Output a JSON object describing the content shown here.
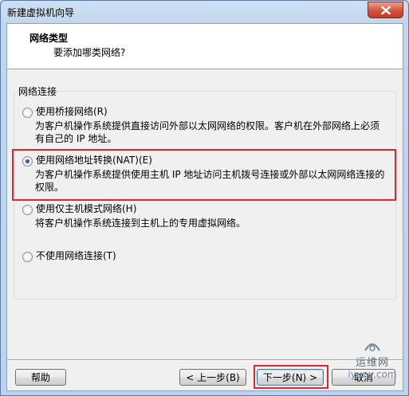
{
  "window": {
    "title": "新建虚拟机向导"
  },
  "header": {
    "title": "网络类型",
    "subtitle": "要添加哪类网络?"
  },
  "group": {
    "label": "网络连接"
  },
  "options": [
    {
      "label": "使用桥接网络(R)",
      "desc_lines": [
        "为客户机操作系统提供直接访问外部以太网网络的权限。客户机在外部网络上必须",
        "有自己的 IP 地址。"
      ],
      "checked": false
    },
    {
      "label": "使用网络地址转换(NAT)(E)",
      "desc_lines": [
        "为客户机操作系统提供使用主机 IP 地址访问主机拨号连接或外部以太网网络连接的",
        "权限。"
      ],
      "checked": true
    },
    {
      "label": "使用仅主机模式网络(H)",
      "desc_lines": [
        "将客户机操作系统连接到主机上的专用虚拟网络。"
      ],
      "checked": false
    },
    {
      "label": "不使用网络连接(T)",
      "desc_lines": [],
      "checked": false
    }
  ],
  "buttons": {
    "help": "帮助",
    "back": "< 上一步(B)",
    "next": "下一步(N) >",
    "cancel": "取消"
  },
  "watermark": {
    "top": "运维网",
    "bottom": "iyunv.com"
  }
}
